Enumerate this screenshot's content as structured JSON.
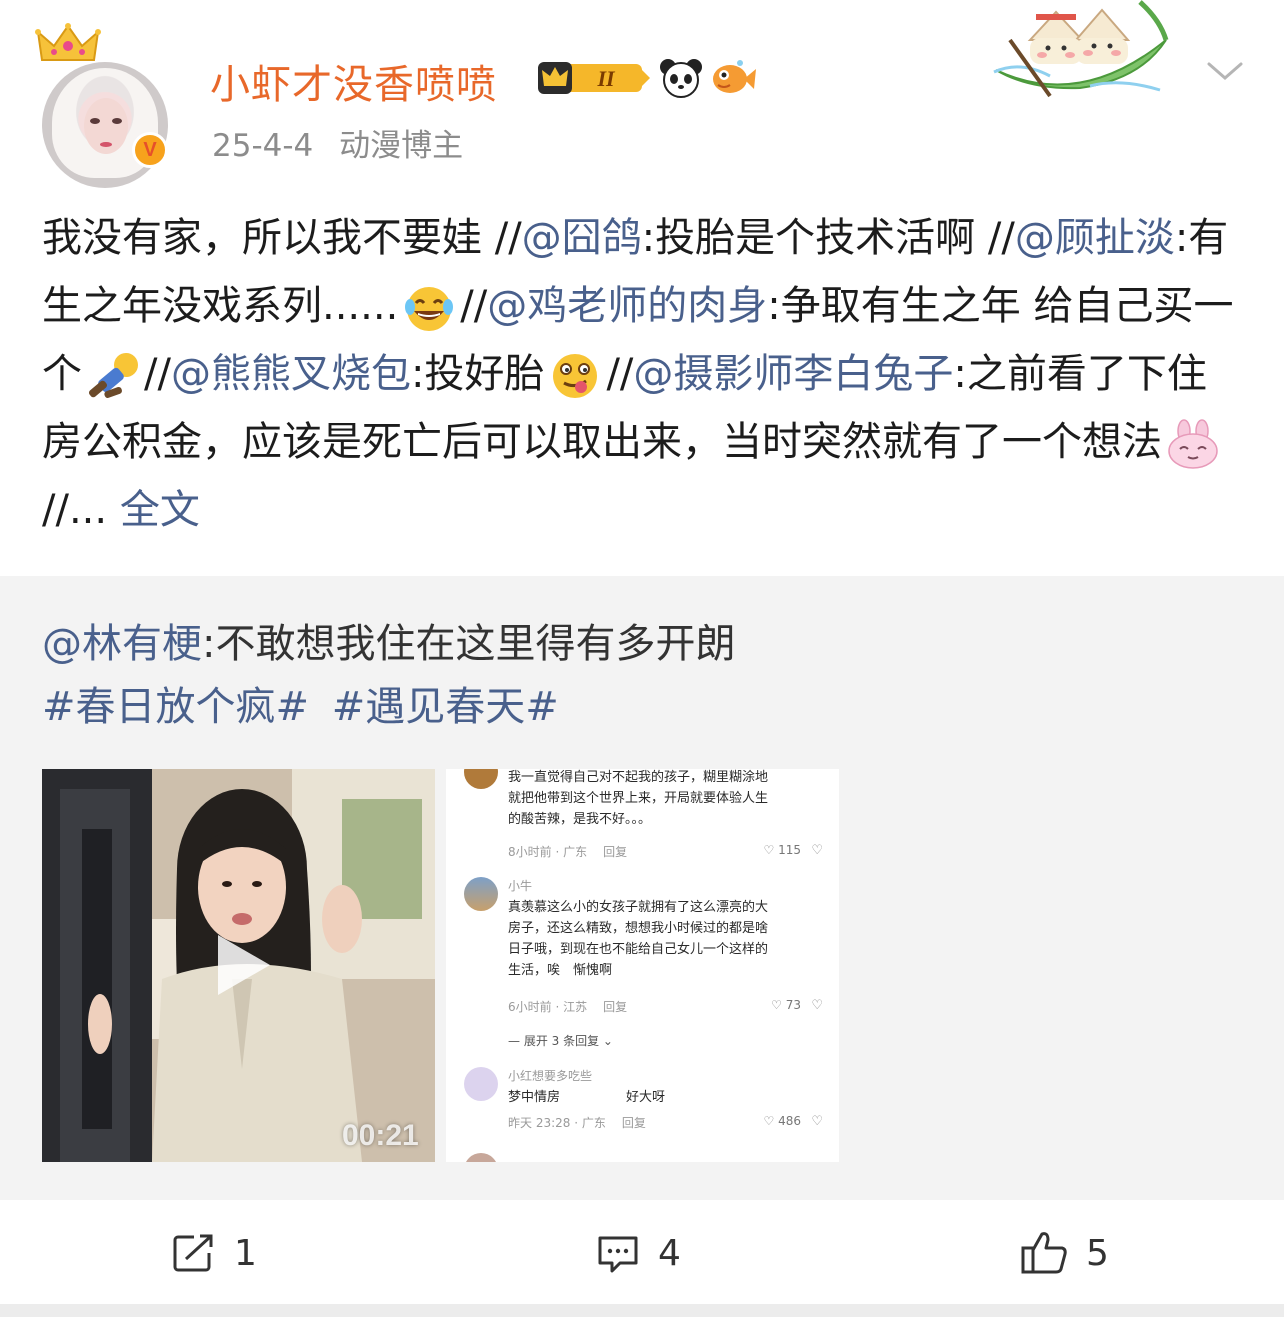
{
  "post": {
    "username": "小虾才没香喷喷",
    "level_badge": "II",
    "date": "25-4-4",
    "tag": "动漫博主",
    "content": {
      "p1": "我没有家，所以我不要娃 //",
      "m1": "@囧鸽",
      "p2": ":投胎是个技术活啊 //",
      "m2": "@顾扯淡",
      "p3": ":有生之年没戏系列......",
      "p4": "//",
      "m3": "@鸡老师的肉身",
      "p5": ":争取有生之年 给自己买一个",
      "p6": "//",
      "m4": "@熊熊叉烧包",
      "p7": ":投好胎",
      "p8": "//",
      "m5": "@摄影师李白兔子",
      "p9": ":之前看了下住房公积金，应该是死亡后可以取出来，当时突然就有了一个想法",
      "p10": "//...",
      "full_text": "全文"
    }
  },
  "repost": {
    "mention": "@林有梗",
    "text": ":不敢想我住在这里得有多开朗",
    "topics": [
      "#春日放个疯#",
      "#遇见春天#"
    ],
    "video_time": "00:21"
  },
  "screenshot_comments": {
    "c1": {
      "lines": [
        "我一直觉得自己对不起我的孩子，糊里糊涂地",
        "就把他带到这个世界上来，开局就要体验人生",
        "的酸苦辣，是我不好。。。"
      ],
      "meta": [
        "8小时前 · 广东",
        "回复"
      ],
      "likes": "115"
    },
    "c2": {
      "name": "小牛",
      "lines": [
        "真羡慕这么小的女孩子就拥有了这么漂亮的大",
        "房子，还这么精致，想想我小时候过的都是啥",
        "日子哦，到现在也不能给自己女儿一个这样的",
        "生活，唉　惭愧啊"
      ],
      "meta": [
        "6小时前 · 江苏",
        "回复"
      ],
      "likes": "73"
    },
    "expand": "展开 3 条回复",
    "c3": {
      "name": "小红想要多吃些",
      "line1a": "梦中情房",
      "line1b": "好大呀",
      "meta": [
        "昨天 23:28 · 广东",
        "回复"
      ],
      "likes": "486"
    }
  },
  "actions": {
    "repost_count": "1",
    "comment_count": "4",
    "like_count": "5"
  }
}
